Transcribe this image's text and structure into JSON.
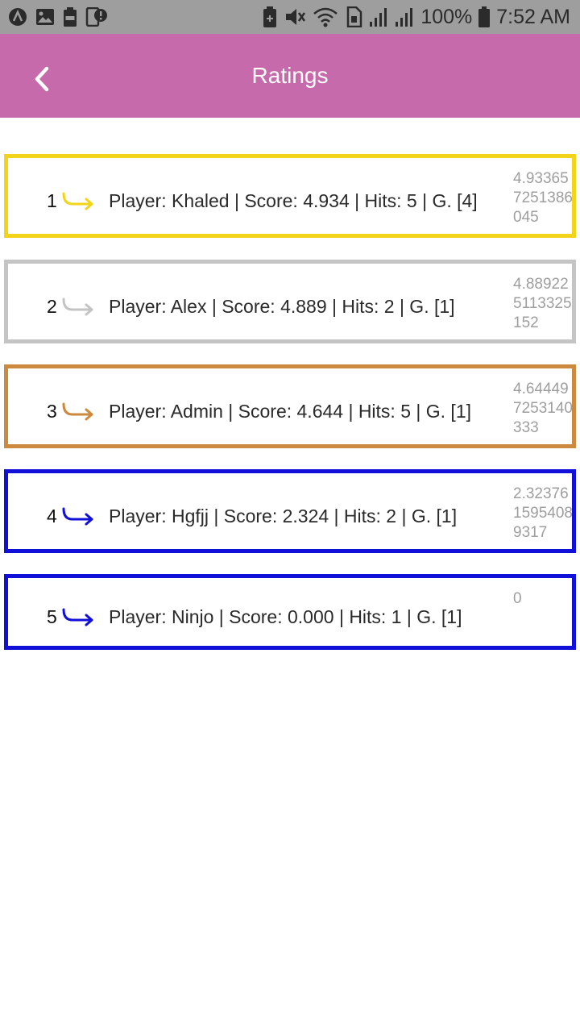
{
  "status_bar": {
    "battery_percent": "100%",
    "time": "7:52 AM",
    "left_icons": [
      "app-logo-icon",
      "image-icon",
      "battery-100-icon",
      "device-alert-icon"
    ],
    "right_icons": [
      "battery-saver-icon",
      "vibrate-off-icon",
      "wifi-icon",
      "sim-icon",
      "signal-icon",
      "signal-icon",
      "battery-icon"
    ]
  },
  "app_bar": {
    "title": "Ratings",
    "back_icon": "chevron-left-icon"
  },
  "ratings": [
    {
      "rank": "1",
      "text": "Player: Khaled | Score: 4.934 | Hits: 5 | G. [4]",
      "raw": "4.933657251386045",
      "color": "#f2d41a"
    },
    {
      "rank": "2",
      "text": "Player: Alex | Score: 4.889 | Hits: 2 | G. [1]",
      "raw": "4.889225113325152",
      "color": "#c4c4c4"
    },
    {
      "rank": "3",
      "text": "Player: Admin | Score: 4.644 | Hits: 5 | G. [1]",
      "raw": "4.644497253140333",
      "color": "#cd8a3e"
    },
    {
      "rank": "4",
      "text": "Player: Hgfjj | Score: 2.324 | Hits: 2 | G. [1]",
      "raw": "2.3237615954089317",
      "color": "#1010d8"
    },
    {
      "rank": "5",
      "text": "Player: Ninjo | Score: 0.000 | Hits: 1 | G. [1]",
      "raw": "0",
      "color": "#1010d8"
    }
  ]
}
